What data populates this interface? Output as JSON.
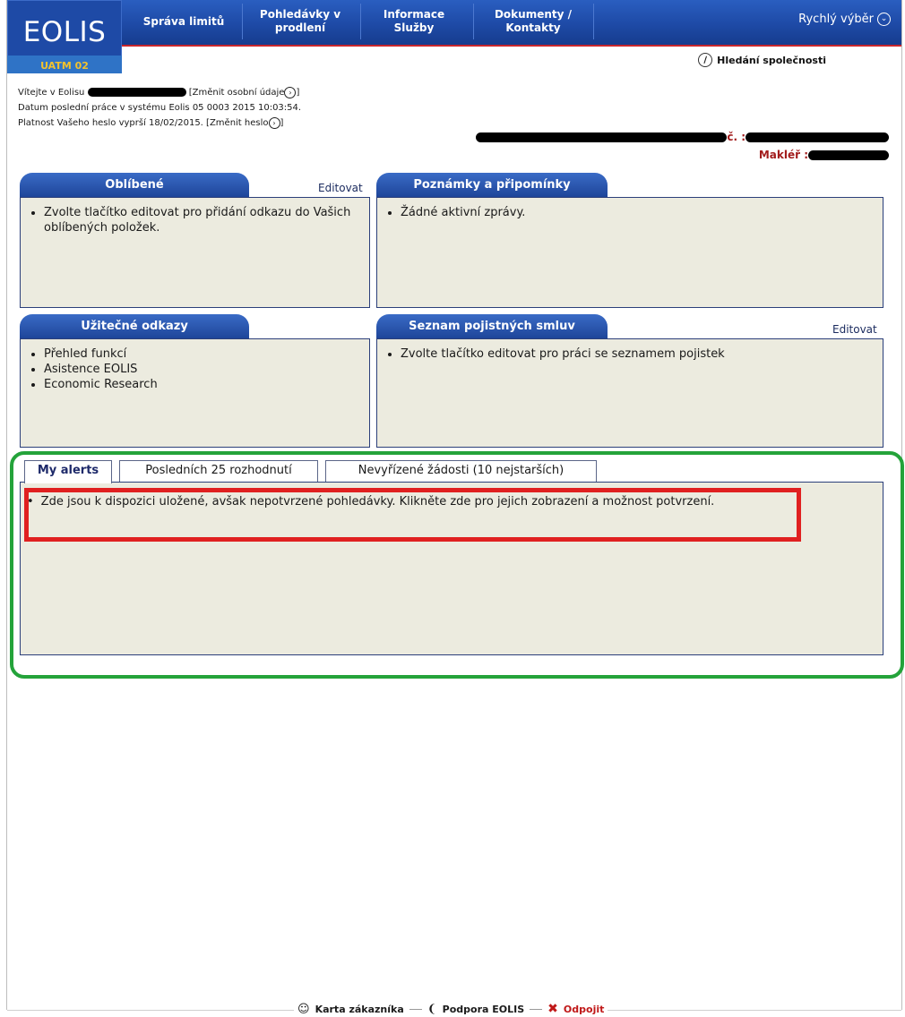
{
  "header": {
    "logo_text": "EOLIS",
    "logo_sub": "UATM 02",
    "nav": [
      "Správa limitů",
      "Pohledávky v prodlení",
      "Informace Služby",
      "Dokumenty / Kontakty"
    ],
    "quick_select": "Rychlý výběr",
    "company_search": "Hledání společnosti"
  },
  "welcome": {
    "line1_prefix": "Vítejte v Eolisu",
    "line1_link": "[Změnit osobní údaje",
    "line2": "Datum poslední práce v systému Eolis 05 0003 2015 10:03:54.",
    "line3_prefix": "Platnost Vašeho heslo vyprší 18/02/2015. [Změnit heslo"
  },
  "client": {
    "cislo_suffix": "č. :",
    "makler_label": "Makléř :"
  },
  "panels": {
    "favorites": {
      "title": "Oblíbené",
      "edit": "Editovat",
      "items": [
        "Zvolte tlačítko editovat pro přidání odkazu do Vašich oblíbených položek."
      ]
    },
    "notes": {
      "title": "Poznámky a připomínky",
      "items": [
        "Žádné aktivní zprávy."
      ]
    },
    "links": {
      "title": "Užitečné odkazy",
      "items": [
        "Přehled funkcí",
        "Asistence EOLIS",
        "Economic Research"
      ]
    },
    "policies": {
      "title": "Seznam pojistných smluv",
      "edit": "Editovat",
      "items": [
        "Zvolte tlačítko editovat pro práci se seznamem pojistek"
      ]
    }
  },
  "tabs": {
    "items": [
      "My alerts",
      "Posledních 25 rozhodnutí",
      "Nevyřízené žádosti (10 nejstarších)"
    ],
    "active": "My alerts",
    "alert": "Zde jsou k dispozici uložené, avšak nepotvrzené pohledávky. Klikněte zde pro jejich zobrazení a možnost potvrzení."
  },
  "footer": {
    "customer_card": "Karta  zákazníka",
    "support": "Podpora  EOLIS",
    "logout": "Odpojit"
  },
  "colors": {
    "nav_blue": "#1e4aa6",
    "panel_bg": "#ecebdf",
    "accent_red": "#c8262c",
    "highlight_green": "#24a33a",
    "highlight_red": "#e02020",
    "logo_yellow": "#f2c22d"
  }
}
